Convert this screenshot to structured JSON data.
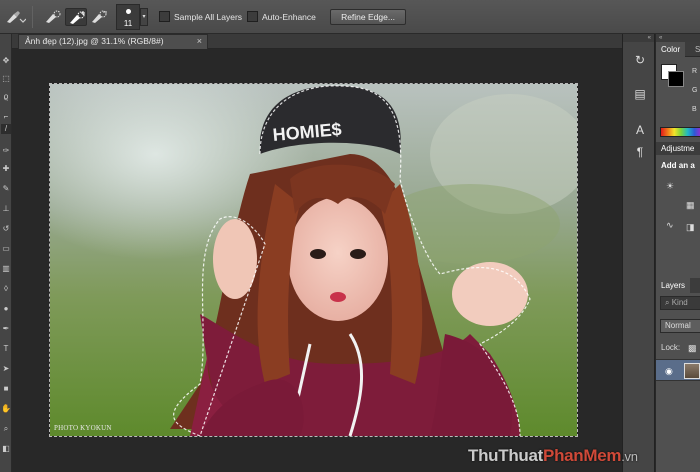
{
  "options_bar": {
    "brush_size": "11",
    "sample_all_layers_label": "Sample All Layers",
    "sample_all_layers_checked": false,
    "auto_enhance_label": "Auto-Enhance",
    "auto_enhance_checked": false,
    "refine_edge_label": "Refine Edge..."
  },
  "document": {
    "tab_title": "Ảnh đẹp (12).jpg @ 31.1% (RGB/8#)",
    "close_glyph": "×",
    "photo_credit": "PHOTO KYOKUN",
    "beanie_text": "HOMIE$"
  },
  "color_panel": {
    "collapse_glyph": "«",
    "tabs": [
      "Color",
      "S"
    ],
    "channels": [
      "R",
      "G",
      "B"
    ],
    "foreground": "#ffffff",
    "background": "#000000"
  },
  "adjustments_panel": {
    "title": "Adjustme",
    "hint": "Add an a"
  },
  "layers_panel": {
    "title": "Layers",
    "filter": "Kind",
    "blend_mode": "Normal",
    "lock_label": "Lock:"
  },
  "icon_column": {
    "collapse_glyph": "«",
    "icons": [
      "history-icon",
      "properties-icon",
      "character-icon",
      "paragraph-icon"
    ]
  },
  "watermark": {
    "part1": "ThuThuat",
    "part2": "PhanMem",
    "part3": ".vn"
  },
  "colors": {
    "accent_red": "#e24d3a",
    "selected_layer": "#5a6d8a"
  }
}
